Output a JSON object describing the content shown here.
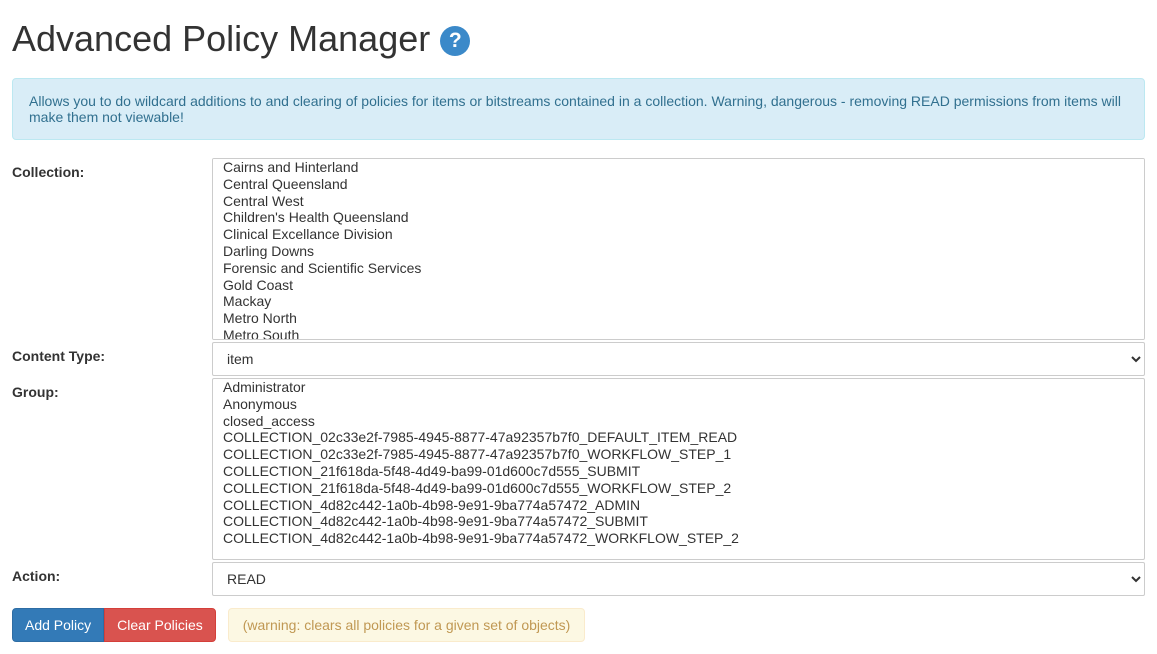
{
  "page": {
    "title": "Advanced Policy Manager",
    "help_symbol": "?"
  },
  "alert": {
    "text": "Allows you to do wildcard additions to and clearing of policies for items or bitstreams contained in a collection. Warning, dangerous - removing READ permissions from items will make them not viewable!"
  },
  "form": {
    "collection": {
      "label": "Collection:",
      "options": [
        "Cairns and Hinterland",
        "Central Queensland",
        "Central West",
        "Children's Health Queensland",
        "Clinical Excellance Division",
        "Darling Downs",
        "Forensic and Scientific Services",
        "Gold Coast",
        "Mackay",
        "Metro North",
        "Metro South"
      ]
    },
    "content_type": {
      "label": "Content Type:",
      "selected": "item",
      "options": [
        "item"
      ]
    },
    "group": {
      "label": "Group:",
      "options": [
        "Administrator",
        "Anonymous",
        "closed_access",
        "COLLECTION_02c33e2f-7985-4945-8877-47a92357b7f0_DEFAULT_ITEM_READ",
        "COLLECTION_02c33e2f-7985-4945-8877-47a92357b7f0_WORKFLOW_STEP_1",
        "COLLECTION_21f618da-5f48-4d49-ba99-01d600c7d555_SUBMIT",
        "COLLECTION_21f618da-5f48-4d49-ba99-01d600c7d555_WORKFLOW_STEP_2",
        "COLLECTION_4d82c442-1a0b-4b98-9e91-9ba774a57472_ADMIN",
        "COLLECTION_4d82c442-1a0b-4b98-9e91-9ba774a57472_SUBMIT",
        "COLLECTION_4d82c442-1a0b-4b98-9e91-9ba774a57472_WORKFLOW_STEP_2"
      ]
    },
    "action": {
      "label": "Action:",
      "selected": "READ",
      "options": [
        "READ"
      ]
    }
  },
  "buttons": {
    "add": "Add Policy",
    "clear": "Clear Policies",
    "warning": "(warning: clears all policies for a given set of objects)"
  }
}
